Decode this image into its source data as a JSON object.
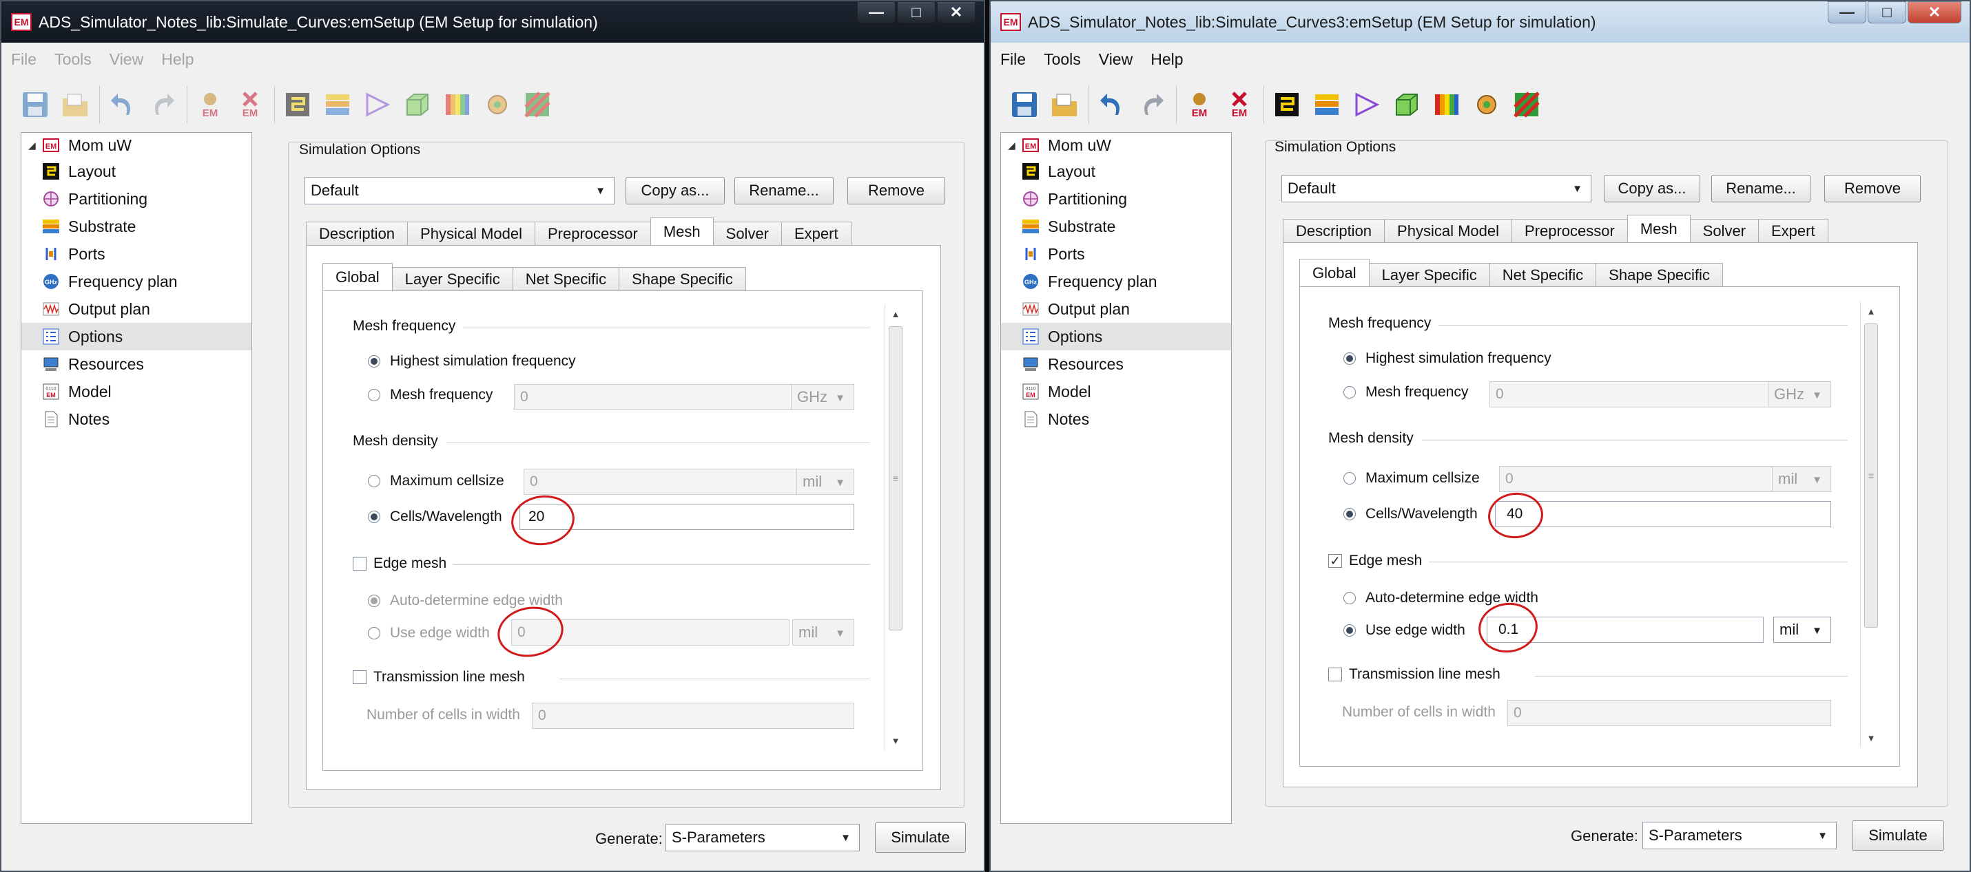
{
  "windows": [
    {
      "title": "ADS_Simulator_Notes_lib:Simulate_Curves:emSetup (EM Setup for simulation)",
      "app_badge": "EM",
      "menu": [
        "File",
        "Tools",
        "View",
        "Help"
      ],
      "tree": {
        "root": "Mom uW",
        "items": [
          "Layout",
          "Partitioning",
          "Substrate",
          "Ports",
          "Frequency plan",
          "Output plan",
          "Options",
          "Resources",
          "Model",
          "Notes"
        ],
        "selected": "Options"
      },
      "sim_options_label": "Simulation Options",
      "preset": "Default",
      "buttons": {
        "copy_as": "Copy as...",
        "rename": "Rename...",
        "remove": "Remove"
      },
      "main_tabs": [
        "Description",
        "Physical Model",
        "Preprocessor",
        "Mesh",
        "Solver",
        "Expert"
      ],
      "active_main_tab": "Mesh",
      "sub_tabs": [
        "Global",
        "Layer Specific",
        "Net Specific",
        "Shape Specific"
      ],
      "active_sub_tab": "Global",
      "mesh_frequency": {
        "title": "Mesh frequency",
        "highest_label": "Highest simulation frequency",
        "highest_checked": true,
        "mesh_freq_label": "Mesh frequency",
        "mesh_freq_value": "0",
        "mesh_freq_unit": "GHz"
      },
      "mesh_density": {
        "title": "Mesh density",
        "max_cell_label": "Maximum cellsize",
        "max_cell_value": "0",
        "max_cell_unit": "mil",
        "cells_label": "Cells/Wavelength",
        "cells_value": "20",
        "cells_checked": true
      },
      "edge_mesh": {
        "title": "Edge mesh",
        "checked": false,
        "auto_label": "Auto-determine edge width",
        "auto_checked": true,
        "use_label": "Use edge width",
        "use_value": "0",
        "use_unit": "mil"
      },
      "transmission": {
        "title": "Transmission line mesh",
        "checked": false,
        "cells_label": "Number of cells in width",
        "cells_value": "0"
      },
      "generate_label": "Generate:",
      "generate_value": "S-Parameters",
      "simulate_label": "Simulate"
    },
    {
      "title": "ADS_Simulator_Notes_lib:Simulate_Curves3:emSetup (EM Setup for simulation)",
      "app_badge": "EM",
      "menu": [
        "File",
        "Tools",
        "View",
        "Help"
      ],
      "tree": {
        "root": "Mom uW",
        "items": [
          "Layout",
          "Partitioning",
          "Substrate",
          "Ports",
          "Frequency plan",
          "Output plan",
          "Options",
          "Resources",
          "Model",
          "Notes"
        ],
        "selected": "Options"
      },
      "sim_options_label": "Simulation Options",
      "preset": "Default",
      "buttons": {
        "copy_as": "Copy as...",
        "rename": "Rename...",
        "remove": "Remove"
      },
      "main_tabs": [
        "Description",
        "Physical Model",
        "Preprocessor",
        "Mesh",
        "Solver",
        "Expert"
      ],
      "active_main_tab": "Mesh",
      "sub_tabs": [
        "Global",
        "Layer Specific",
        "Net Specific",
        "Shape Specific"
      ],
      "active_sub_tab": "Global",
      "mesh_frequency": {
        "title": "Mesh frequency",
        "highest_label": "Highest simulation frequency",
        "highest_checked": true,
        "mesh_freq_label": "Mesh frequency",
        "mesh_freq_value": "0",
        "mesh_freq_unit": "GHz"
      },
      "mesh_density": {
        "title": "Mesh density",
        "max_cell_label": "Maximum cellsize",
        "max_cell_value": "0",
        "max_cell_unit": "mil",
        "cells_label": "Cells/Wavelength",
        "cells_value": "40",
        "cells_checked": true
      },
      "edge_mesh": {
        "title": "Edge mesh",
        "checked": true,
        "auto_label": "Auto-determine edge width",
        "auto_checked": false,
        "use_label": "Use edge width",
        "use_value": "0.1",
        "use_unit": "mil"
      },
      "transmission": {
        "title": "Transmission line mesh",
        "checked": false,
        "cells_label": "Number of cells in width",
        "cells_value": "0"
      },
      "generate_label": "Generate:",
      "generate_value": "S-Parameters",
      "simulate_label": "Simulate"
    }
  ],
  "colors": {
    "annotation_red": "#d11a1a",
    "em_badge": "#c8102e"
  }
}
